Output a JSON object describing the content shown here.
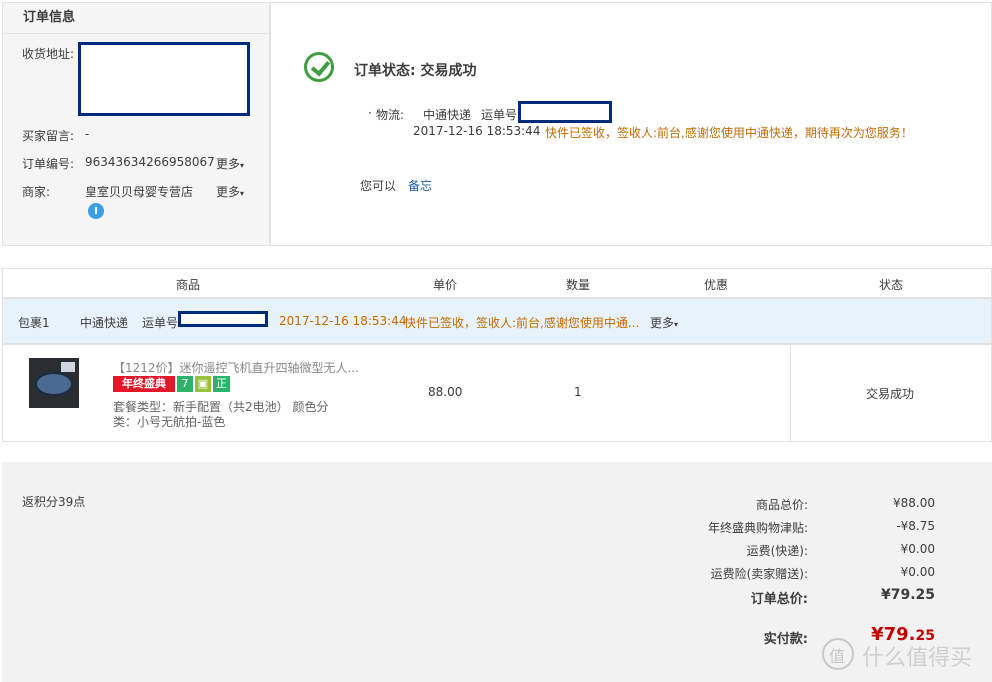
{
  "order_info": {
    "title": "订单信息",
    "address_label": "收货地址:",
    "message_label": "买家留言:",
    "message_value": "-",
    "order_no_label": "订单编号:",
    "order_no_value": "96343634266958067",
    "more": "更多",
    "seller_label": "商家:",
    "seller_value": "皇室贝贝母婴专营店"
  },
  "status": {
    "title": "订单状态: 交易成功",
    "logistics_label": "物流:",
    "carrier": "中通快递",
    "tracking_label": "运单号",
    "time": "2017-12-16 18:53:44",
    "message": "快件已签收，签收人:前台,感谢您使用中通快递，期待再次为您服务！",
    "you_can": "您可以",
    "memo": "备忘"
  },
  "table": {
    "headers": [
      "商品",
      "单价",
      "数量",
      "优惠",
      "状态"
    ],
    "package": {
      "label": "包裹1",
      "carrier": "中通快递",
      "tracking_label": "运单号",
      "time": "2017-12-16 18:53:44",
      "message": "快件已签收，签收人:前台,感谢您使用中通...",
      "more": "更多"
    },
    "item": {
      "title": "【1212价】迷你遥控飞机直升四轴微型无人...",
      "badge_year": "年终盛典",
      "badge_7": "7",
      "badge_zheng": "正",
      "sku_line1": "套餐类型：新手配置（共2电池） 颜色分",
      "sku_line2": "类：小号无航拍-蓝色",
      "price": "88.00",
      "qty": "1",
      "discount": "",
      "status": "交易成功"
    }
  },
  "summary": {
    "points": "返积分39点",
    "rows": [
      {
        "label": "商品总价:",
        "value": "¥88.00"
      },
      {
        "label": "年终盛典购物津贴:",
        "value": "-¥8.75"
      },
      {
        "label": "运费(快递):",
        "value": "¥0.00"
      },
      {
        "label": "运费险(卖家赠送):",
        "value": "¥0.00"
      }
    ],
    "order_total_label": "订单总价:",
    "order_total_value": "¥79.25",
    "paid_label": "实付款:",
    "paid_main": "¥79.",
    "paid_decimal": "25"
  },
  "watermark": "什么值得买",
  "colors": {
    "accent_orange": "#c36b00",
    "link_blue": "#1f5ea8",
    "success_green": "#3f9d3f",
    "price_red": "#c40000",
    "redaction_navy": "#002a7a"
  }
}
